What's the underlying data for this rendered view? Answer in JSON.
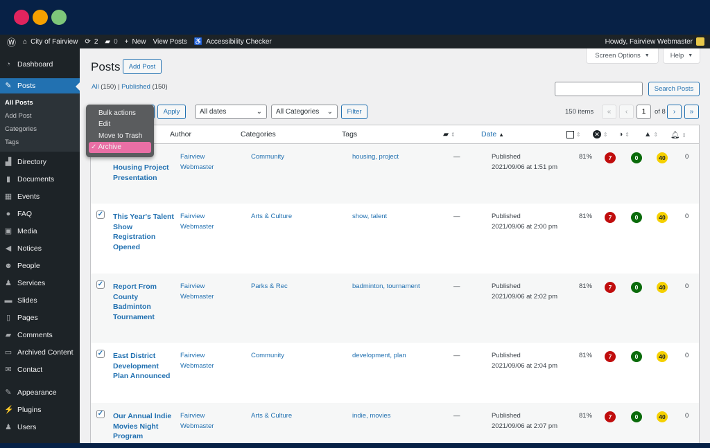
{
  "window": {
    "dots": [
      "#e0245e",
      "#f5a000",
      "#7ec77a"
    ]
  },
  "adminbar": {
    "site": "City of Fairview",
    "updates": "2",
    "comments": "0",
    "new": "New",
    "view_posts": "View Posts",
    "accessibility": "Accessibility Checker",
    "howdy": "Howdy, Fairview Webmaster"
  },
  "sidebar": {
    "dashboard": "Dashboard",
    "posts": "Posts",
    "submenu": [
      "All Posts",
      "Add Post",
      "Categories",
      "Tags"
    ],
    "items": [
      {
        "label": "Directory",
        "icon": "▟"
      },
      {
        "label": "Documents",
        "icon": "▮"
      },
      {
        "label": "Events",
        "icon": "▦"
      },
      {
        "label": "FAQ",
        "icon": "●"
      },
      {
        "label": "Media",
        "icon": "▣"
      },
      {
        "label": "Notices",
        "icon": "◀"
      },
      {
        "label": "People",
        "icon": "☻"
      },
      {
        "label": "Services",
        "icon": "♟"
      },
      {
        "label": "Slides",
        "icon": "▬"
      },
      {
        "label": "Pages",
        "icon": "▯"
      },
      {
        "label": "Comments",
        "icon": "▰"
      },
      {
        "label": "Archived Content",
        "icon": "▭"
      },
      {
        "label": "Contact",
        "icon": "✉"
      }
    ],
    "items2": [
      {
        "label": "Appearance",
        "icon": "✎"
      },
      {
        "label": "Plugins",
        "icon": "⚡"
      },
      {
        "label": "Users",
        "icon": "♟"
      }
    ]
  },
  "main": {
    "title": "Posts",
    "add_post": "Add Post",
    "screen_options": "Screen Options",
    "help": "Help",
    "filters": {
      "all": "All",
      "all_count": "(150)",
      "sep": "|",
      "published": "Published",
      "published_count": "(150)"
    },
    "search_button": "Search Posts",
    "search_value": "",
    "apply": "Apply",
    "dates": "All dates",
    "categories": "All Categories",
    "filter": "Filter",
    "items_count": "150 items",
    "page": "1",
    "of_pages": "of 8",
    "bulk_menu": [
      "Bulk actions",
      "Edit",
      "Move to Trash",
      "✓ Archive"
    ],
    "columns": {
      "author": "Author",
      "categories": "Categories",
      "tags": "Tags",
      "date": "Date"
    },
    "rows": [
      {
        "title": "Housing Project Presentation",
        "author": "Fairview Webmaster",
        "category": "Community",
        "tags": "housing, project",
        "comments": "—",
        "status": "Published",
        "date": "2021/09/06 at 1:51 pm",
        "pct": "81%",
        "errors": "7",
        "contrast": "0",
        "warnings": "40",
        "notices": "0"
      },
      {
        "title": "This Year's Talent Show Registration Opened",
        "author": "Fairview Webmaster",
        "category": "Arts & Culture",
        "tags": "show, talent",
        "comments": "—",
        "status": "Published",
        "date": "2021/09/06 at 2:00 pm",
        "pct": "81%",
        "errors": "7",
        "contrast": "0",
        "warnings": "40",
        "notices": "0"
      },
      {
        "title": "Report From County Badminton Tournament",
        "author": "Fairview Webmaster",
        "category": "Parks & Rec",
        "tags": "badminton, tournament",
        "comments": "—",
        "status": "Published",
        "date": "2021/09/06 at 2:02 pm",
        "pct": "81%",
        "errors": "7",
        "contrast": "0",
        "warnings": "40",
        "notices": "0"
      },
      {
        "title": "East District Development Plan Announced",
        "author": "Fairview Webmaster",
        "category": "Community",
        "tags": "development, plan",
        "comments": "—",
        "status": "Published",
        "date": "2021/09/06 at 2:04 pm",
        "pct": "81%",
        "errors": "7",
        "contrast": "0",
        "warnings": "40",
        "notices": "0"
      },
      {
        "title": "Our Annual Indie Movies Night Program Revealed",
        "author": "Fairview Webmaster",
        "category": "Arts & Culture",
        "tags": "indie, movies",
        "comments": "—",
        "status": "Published",
        "date": "2021/09/06 at 2:07 pm",
        "pct": "81%",
        "errors": "7",
        "contrast": "0",
        "warnings": "40",
        "notices": "0"
      }
    ]
  },
  "colors": {
    "error": "#c00d0d",
    "contrast": "#0a6b0a",
    "warning": "#f5d000",
    "accent": "#2271b1"
  }
}
